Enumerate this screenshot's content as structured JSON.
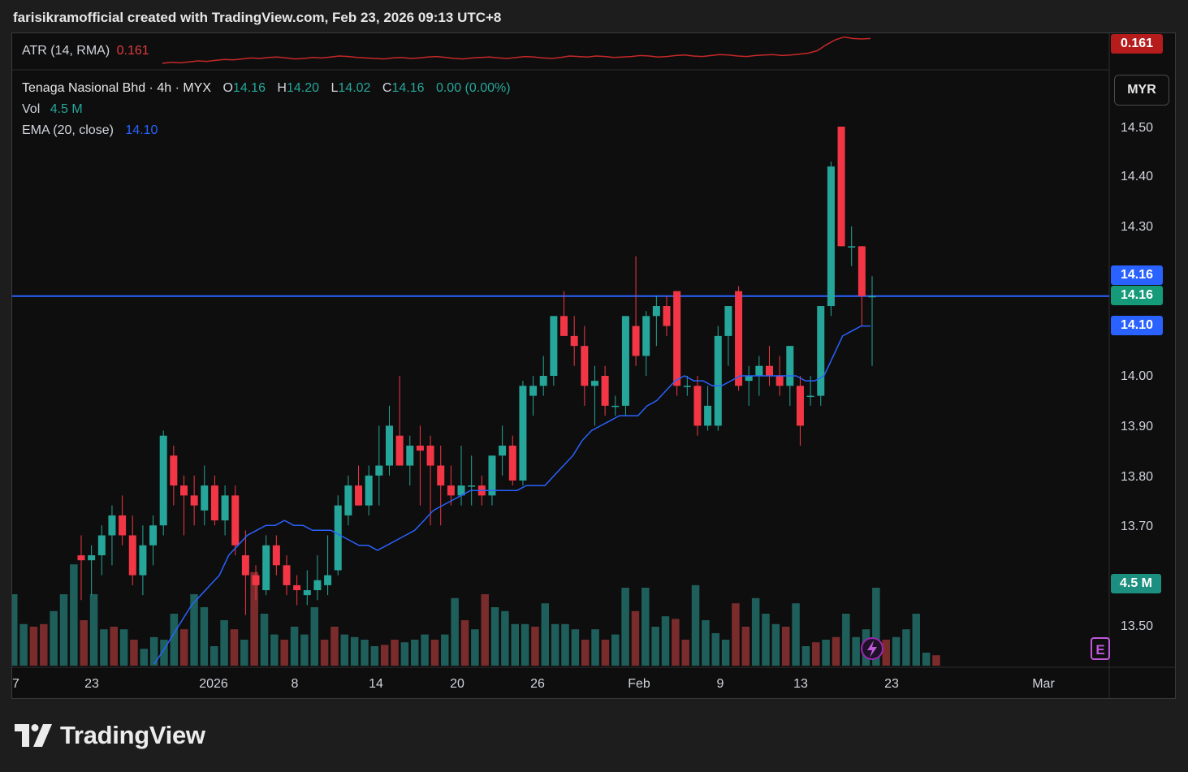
{
  "header": {
    "caption": "farisikramofficial created with TradingView.com, Feb 23, 2026 09:13 UTC+8"
  },
  "atr": {
    "label": "ATR (14, RMA)",
    "value": "0.161",
    "badge": "0.161",
    "color": "#c62828"
  },
  "legend": {
    "symbol": "Tenaga Nasional Bhd · 4h · MYX",
    "o_label": "O",
    "o_value": "14.16",
    "h_label": "H",
    "h_value": "14.20",
    "l_label": "L",
    "l_value": "14.02",
    "c_label": "C",
    "c_value": "14.16",
    "change": "0.00 (0.00%)",
    "vol_label": "Vol",
    "vol_value": "4.5 M",
    "ema_label": "EMA (20, close)",
    "ema_value": "14.10"
  },
  "currency_button": "MYR",
  "badges": {
    "last_price": "14.16",
    "close_price": "14.16",
    "ema": "14.10",
    "volume": "4.5 M"
  },
  "colors": {
    "up": "#26a69a",
    "down": "#f23645",
    "vol_up": "#1f5f5b",
    "vol_down": "#7a2c2c",
    "ema": "#2962ff",
    "price_line": "#2962ff",
    "atr": "#c62828"
  },
  "brand": {
    "name": "TradingView"
  },
  "chart_data": {
    "type": "candlestick",
    "price_axis": {
      "min": 13.45,
      "max": 14.55,
      "ticks": [
        "13.50",
        "13.70",
        "13.80",
        "13.90",
        "14.00",
        "14.30",
        "14.40",
        "14.50"
      ]
    },
    "time_axis": [
      "7",
      "23",
      "2026",
      "8",
      "14",
      "20",
      "26",
      "Feb",
      "9",
      "13",
      "23",
      "Mar"
    ],
    "price_line": 14.16,
    "candles": [
      {
        "o": 13.64,
        "h": 13.68,
        "l": 13.55,
        "c": 13.63
      },
      {
        "o": 13.63,
        "h": 13.66,
        "l": 13.56,
        "c": 13.64
      },
      {
        "o": 13.64,
        "h": 13.7,
        "l": 13.6,
        "c": 13.68
      },
      {
        "o": 13.68,
        "h": 13.74,
        "l": 13.62,
        "c": 13.72
      },
      {
        "o": 13.72,
        "h": 13.76,
        "l": 13.66,
        "c": 13.68
      },
      {
        "o": 13.68,
        "h": 13.72,
        "l": 13.58,
        "c": 13.6
      },
      {
        "o": 13.6,
        "h": 13.7,
        "l": 13.56,
        "c": 13.66
      },
      {
        "o": 13.66,
        "h": 13.72,
        "l": 13.62,
        "c": 13.7
      },
      {
        "o": 13.7,
        "h": 13.89,
        "l": 13.68,
        "c": 13.88
      },
      {
        "o": 13.84,
        "h": 13.86,
        "l": 13.74,
        "c": 13.78
      },
      {
        "o": 13.78,
        "h": 13.8,
        "l": 13.68,
        "c": 13.76
      },
      {
        "o": 13.76,
        "h": 13.8,
        "l": 13.7,
        "c": 13.74
      },
      {
        "o": 13.73,
        "h": 13.82,
        "l": 13.7,
        "c": 13.78
      },
      {
        "o": 13.78,
        "h": 13.8,
        "l": 13.7,
        "c": 13.71
      },
      {
        "o": 13.71,
        "h": 13.78,
        "l": 13.68,
        "c": 13.76
      },
      {
        "o": 13.76,
        "h": 13.78,
        "l": 13.64,
        "c": 13.66
      },
      {
        "o": 13.64,
        "h": 13.69,
        "l": 13.52,
        "c": 13.6
      },
      {
        "o": 13.6,
        "h": 13.62,
        "l": 13.55,
        "c": 13.58
      },
      {
        "o": 13.57,
        "h": 13.68,
        "l": 13.56,
        "c": 13.66
      },
      {
        "o": 13.66,
        "h": 13.68,
        "l": 13.6,
        "c": 13.62
      },
      {
        "o": 13.62,
        "h": 13.64,
        "l": 13.56,
        "c": 13.58
      },
      {
        "o": 13.58,
        "h": 13.6,
        "l": 13.54,
        "c": 13.57
      },
      {
        "o": 13.56,
        "h": 13.61,
        "l": 13.54,
        "c": 13.57
      },
      {
        "o": 13.57,
        "h": 13.64,
        "l": 13.55,
        "c": 13.59
      },
      {
        "o": 13.58,
        "h": 13.68,
        "l": 13.56,
        "c": 13.6
      },
      {
        "o": 13.61,
        "h": 13.76,
        "l": 13.6,
        "c": 13.74
      },
      {
        "o": 13.72,
        "h": 13.8,
        "l": 13.7,
        "c": 13.78
      },
      {
        "o": 13.78,
        "h": 13.82,
        "l": 13.74,
        "c": 13.74
      },
      {
        "o": 13.74,
        "h": 13.82,
        "l": 13.72,
        "c": 13.8
      },
      {
        "o": 13.8,
        "h": 13.9,
        "l": 13.74,
        "c": 13.82
      },
      {
        "o": 13.82,
        "h": 13.94,
        "l": 13.8,
        "c": 13.9
      },
      {
        "o": 13.88,
        "h": 14.0,
        "l": 13.84,
        "c": 13.82
      },
      {
        "o": 13.82,
        "h": 13.88,
        "l": 13.78,
        "c": 13.86
      },
      {
        "o": 13.86,
        "h": 13.9,
        "l": 13.74,
        "c": 13.85
      },
      {
        "o": 13.86,
        "h": 13.88,
        "l": 13.7,
        "c": 13.82
      },
      {
        "o": 13.82,
        "h": 13.86,
        "l": 13.7,
        "c": 13.78
      },
      {
        "o": 13.78,
        "h": 13.82,
        "l": 13.74,
        "c": 13.76
      },
      {
        "o": 13.76,
        "h": 13.86,
        "l": 13.74,
        "c": 13.78
      },
      {
        "o": 13.78,
        "h": 13.84,
        "l": 13.74,
        "c": 13.78
      },
      {
        "o": 13.78,
        "h": 13.8,
        "l": 13.74,
        "c": 13.76
      },
      {
        "o": 13.76,
        "h": 13.84,
        "l": 13.74,
        "c": 13.84
      },
      {
        "o": 13.84,
        "h": 13.9,
        "l": 13.8,
        "c": 13.86
      },
      {
        "o": 13.86,
        "h": 13.88,
        "l": 13.78,
        "c": 13.79
      },
      {
        "o": 13.79,
        "h": 13.99,
        "l": 13.78,
        "c": 13.98
      },
      {
        "o": 13.96,
        "h": 14.0,
        "l": 13.92,
        "c": 13.98
      },
      {
        "o": 13.98,
        "h": 14.04,
        "l": 13.96,
        "c": 14.0
      },
      {
        "o": 14.0,
        "h": 14.12,
        "l": 13.98,
        "c": 14.12
      },
      {
        "o": 14.12,
        "h": 14.17,
        "l": 14.08,
        "c": 14.08
      },
      {
        "o": 14.08,
        "h": 14.12,
        "l": 14.02,
        "c": 14.06
      },
      {
        "o": 14.06,
        "h": 14.1,
        "l": 13.94,
        "c": 13.98
      },
      {
        "o": 13.98,
        "h": 14.02,
        "l": 13.9,
        "c": 13.99
      },
      {
        "o": 14.0,
        "h": 14.02,
        "l": 13.92,
        "c": 13.94
      },
      {
        "o": 13.94,
        "h": 13.96,
        "l": 13.92,
        "c": 13.94
      },
      {
        "o": 13.94,
        "h": 14.12,
        "l": 13.92,
        "c": 14.12
      },
      {
        "o": 14.1,
        "h": 14.24,
        "l": 14.02,
        "c": 14.04
      },
      {
        "o": 14.04,
        "h": 14.13,
        "l": 14.0,
        "c": 14.12
      },
      {
        "o": 14.12,
        "h": 14.16,
        "l": 14.06,
        "c": 14.14
      },
      {
        "o": 14.14,
        "h": 14.16,
        "l": 14.08,
        "c": 14.1
      },
      {
        "o": 14.17,
        "h": 14.17,
        "l": 13.96,
        "c": 13.98
      },
      {
        "o": 13.98,
        "h": 14.0,
        "l": 13.96,
        "c": 13.98
      },
      {
        "o": 13.98,
        "h": 14.0,
        "l": 13.88,
        "c": 13.9
      },
      {
        "o": 13.9,
        "h": 13.98,
        "l": 13.89,
        "c": 13.94
      },
      {
        "o": 13.9,
        "h": 14.1,
        "l": 13.89,
        "c": 14.08
      },
      {
        "o": 14.08,
        "h": 14.14,
        "l": 14.02,
        "c": 14.14
      },
      {
        "o": 14.17,
        "h": 14.18,
        "l": 13.97,
        "c": 13.98
      },
      {
        "o": 13.99,
        "h": 14.02,
        "l": 13.94,
        "c": 14.0
      },
      {
        "o": 14.0,
        "h": 14.04,
        "l": 13.96,
        "c": 14.02
      },
      {
        "o": 14.02,
        "h": 14.06,
        "l": 13.98,
        "c": 14.0
      },
      {
        "o": 14.0,
        "h": 14.04,
        "l": 13.96,
        "c": 13.98
      },
      {
        "o": 13.98,
        "h": 14.06,
        "l": 13.94,
        "c": 14.06
      },
      {
        "o": 13.98,
        "h": 14.0,
        "l": 13.86,
        "c": 13.9
      },
      {
        "o": 13.96,
        "h": 14.0,
        "l": 13.94,
        "c": 13.96
      },
      {
        "o": 13.96,
        "h": 14.14,
        "l": 13.94,
        "c": 14.14
      },
      {
        "o": 14.14,
        "h": 14.43,
        "l": 14.12,
        "c": 14.42
      },
      {
        "o": 14.5,
        "h": 14.5,
        "l": 14.26,
        "c": 14.26
      },
      {
        "o": 14.26,
        "h": 14.3,
        "l": 14.22,
        "c": 14.26
      },
      {
        "o": 14.26,
        "h": 14.26,
        "l": 14.1,
        "c": 14.16
      },
      {
        "o": 14.16,
        "h": 14.2,
        "l": 14.02,
        "c": 14.16
      }
    ],
    "volume": [
      0.55,
      0.32,
      0.3,
      0.32,
      0.42,
      0.55,
      0.78,
      0.35,
      0.55,
      0.28,
      0.3,
      0.28,
      0.2,
      0.13,
      0.22,
      0.2,
      0.4,
      0.28,
      0.55,
      0.45,
      0.15,
      0.35,
      0.28,
      0.2,
      0.72,
      0.4,
      0.24,
      0.2,
      0.3,
      0.24,
      0.45,
      0.2,
      0.3,
      0.24,
      0.22,
      0.2,
      0.15,
      0.16,
      0.2,
      0.18,
      0.2,
      0.24,
      0.2,
      0.24,
      0.52,
      0.35,
      0.28,
      0.55,
      0.45,
      0.42,
      0.32,
      0.32,
      0.3,
      0.48,
      0.32,
      0.32,
      0.28,
      0.2,
      0.28,
      0.2,
      0.24,
      0.6,
      0.42,
      0.6,
      0.3,
      0.38,
      0.36,
      0.2,
      0.62,
      0.35,
      0.25,
      0.2,
      0.48,
      0.3,
      0.52,
      0.4,
      0.32,
      0.3,
      0.48,
      0.15,
      0.18,
      0.2,
      0.22,
      0.4,
      0.22,
      0.28,
      0.6,
      0.2,
      0.22,
      0.28,
      0.4,
      0.1,
      0.08
    ],
    "ema": [
      13.42,
      13.45,
      13.48,
      13.51,
      13.54,
      13.56,
      13.58,
      13.6,
      13.64,
      13.66,
      13.68,
      13.69,
      13.7,
      13.7,
      13.71,
      13.7,
      13.7,
      13.69,
      13.69,
      13.69,
      13.68,
      13.67,
      13.66,
      13.66,
      13.65,
      13.66,
      13.67,
      13.68,
      13.69,
      13.71,
      13.73,
      13.74,
      13.75,
      13.76,
      13.77,
      13.77,
      13.77,
      13.77,
      13.77,
      13.77,
      13.78,
      13.78,
      13.78,
      13.8,
      13.82,
      13.84,
      13.87,
      13.89,
      13.9,
      13.91,
      13.92,
      13.92,
      13.92,
      13.94,
      13.95,
      13.97,
      13.99,
      14.0,
      13.99,
      13.99,
      13.98,
      13.98,
      13.99,
      14.0,
      14.0,
      14.0,
      14.0,
      14.0,
      14.0,
      14.0,
      13.99,
      13.99,
      14.0,
      14.04,
      14.08,
      14.09,
      14.1,
      14.1
    ],
    "atr_series": [
      0.11,
      0.112,
      0.111,
      0.113,
      0.115,
      0.114,
      0.116,
      0.118,
      0.117,
      0.119,
      0.121,
      0.12,
      0.122,
      0.123,
      0.121,
      0.119,
      0.12,
      0.122,
      0.121,
      0.123,
      0.125,
      0.124,
      0.122,
      0.121,
      0.12,
      0.119,
      0.121,
      0.122,
      0.12,
      0.121,
      0.123,
      0.124,
      0.122,
      0.12,
      0.119,
      0.121,
      0.122,
      0.123,
      0.121,
      0.12,
      0.122,
      0.124,
      0.123,
      0.121,
      0.12,
      0.122,
      0.125,
      0.124,
      0.123,
      0.125,
      0.124,
      0.122,
      0.123,
      0.124,
      0.126,
      0.125,
      0.123,
      0.124,
      0.126,
      0.127,
      0.125,
      0.124,
      0.126,
      0.128,
      0.127,
      0.125,
      0.124,
      0.126,
      0.127,
      0.128,
      0.126,
      0.127,
      0.129,
      0.131,
      0.136,
      0.148,
      0.158,
      0.164,
      0.161,
      0.16,
      0.161
    ]
  }
}
